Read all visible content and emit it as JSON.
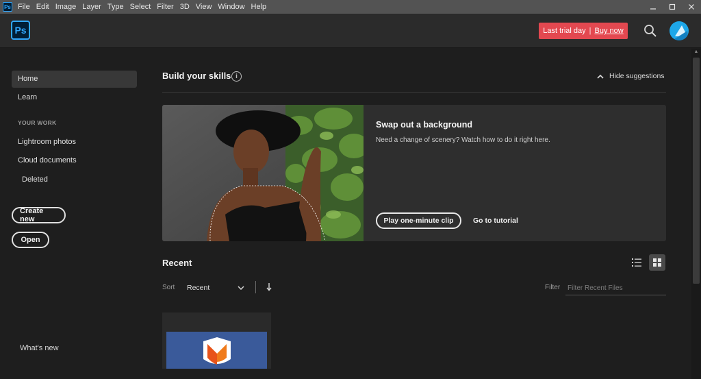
{
  "menubar": {
    "items": [
      "File",
      "Edit",
      "Image",
      "Layer",
      "Type",
      "Select",
      "Filter",
      "3D",
      "View",
      "Window",
      "Help"
    ],
    "app_icon_text": "Ps"
  },
  "header": {
    "logo_text": "Ps",
    "trial_text": "Last trial day",
    "trial_separator": "|",
    "buy_now": "Buy now",
    "trial_color": "#e34850",
    "accent_color": "#31a8ff"
  },
  "sidebar": {
    "home": "Home",
    "learn": "Learn",
    "your_work_label": "YOUR WORK",
    "lightroom": "Lightroom photos",
    "cloud": "Cloud documents",
    "deleted": "Deleted",
    "create_new": "Create new",
    "open": "Open",
    "whats_new": "What's new"
  },
  "main": {
    "build_skills": "Build your skills",
    "info_symbol": "i",
    "hide_suggestions": "Hide suggestions",
    "card": {
      "title": "Swap out a background",
      "description": "Need a change of scenery? Watch how to do it right here.",
      "play_button": "Play one-minute clip",
      "tutorial_link": "Go to tutorial"
    },
    "recent": {
      "title": "Recent",
      "sort_label": "Sort",
      "sort_value": "Recent",
      "filter_label": "Filter",
      "filter_placeholder": "Filter Recent Files"
    }
  }
}
